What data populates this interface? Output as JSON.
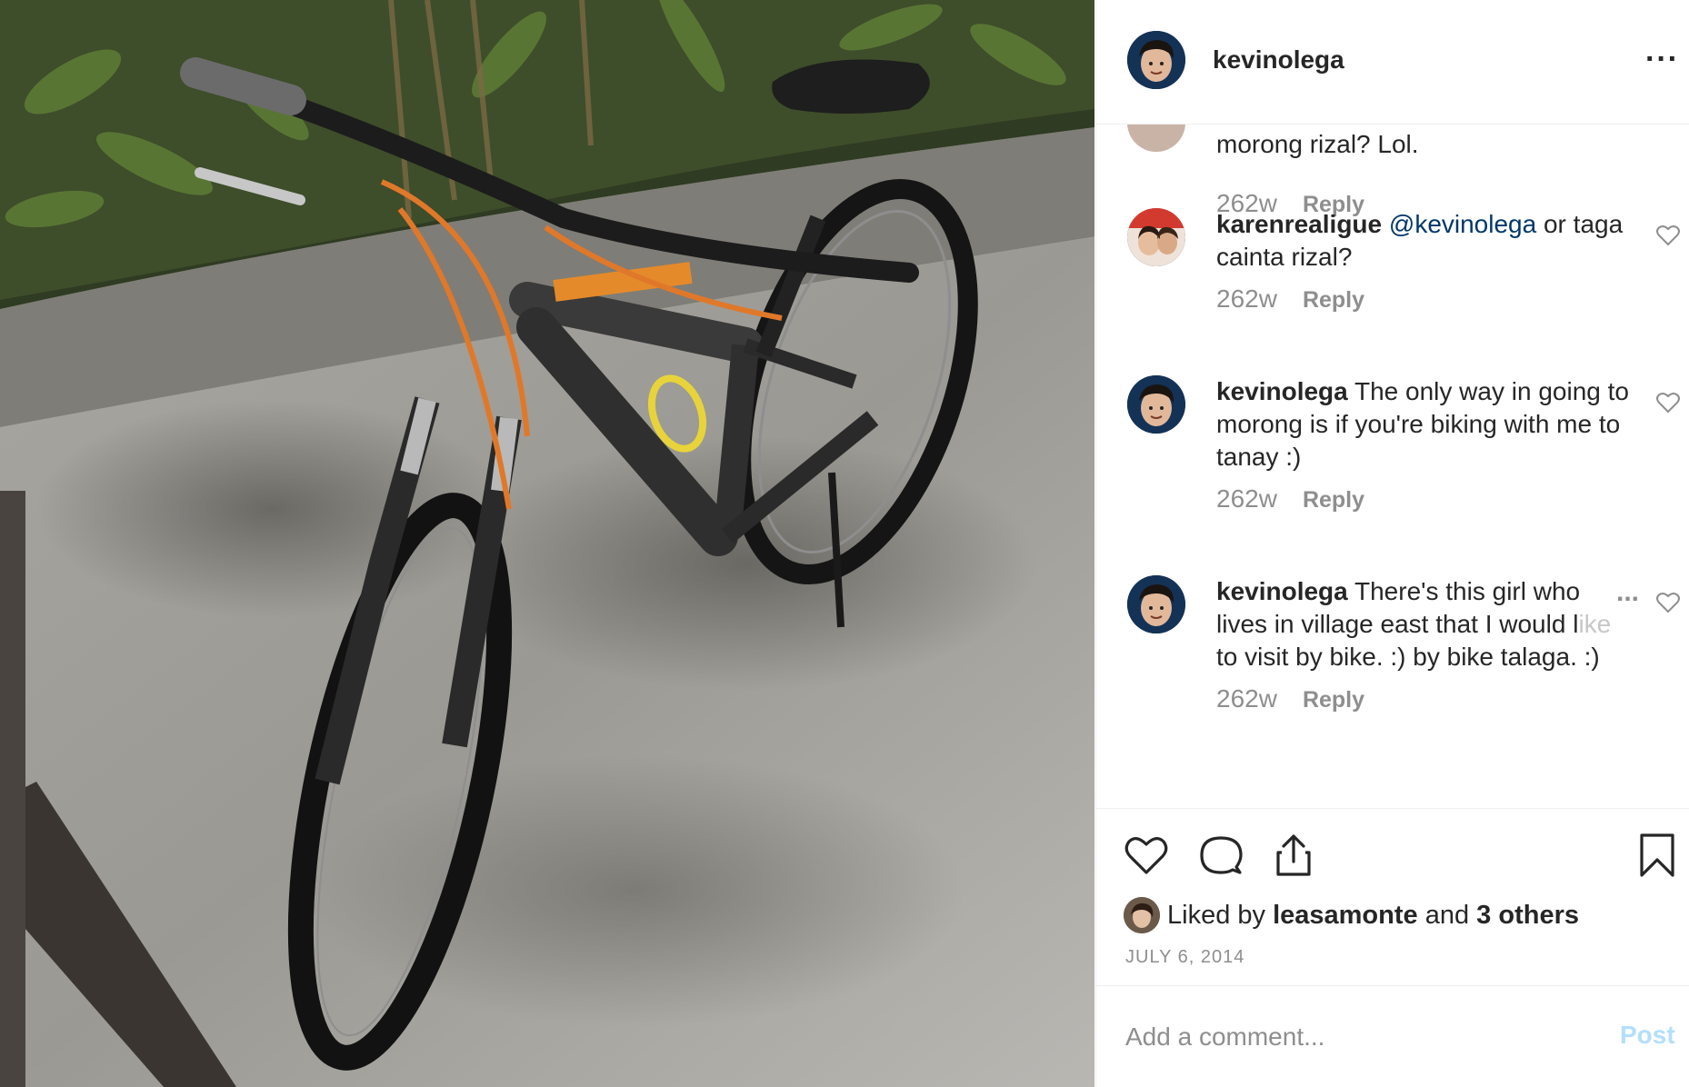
{
  "post": {
    "author": "kevinolega",
    "more_icon": "more-horizontal-icon",
    "liked_by_prefix": "Liked by",
    "liked_by_user": "leasamonte",
    "liked_by_joiner": "and",
    "liked_by_others": "3 others",
    "date": "JULY 6, 2014"
  },
  "comments": [
    {
      "text": "morong rizal? Lol.",
      "time": "262w",
      "reply": "Reply"
    },
    {
      "user": "karenrealigue",
      "mention": "@kevinolega",
      "text": " or taga cainta rizal?",
      "time": "262w",
      "reply": "Reply"
    },
    {
      "user": "kevinolega",
      "text": " The only way in going to morong is if you're biking with me to tanay :)",
      "time": "262w",
      "reply": "Reply"
    },
    {
      "user": "kevinolega",
      "text_a": " There's this girl who lives in village east that I would l",
      "text_fade": "ike",
      "text_b": " to visit by bike. :) by bike talaga. :)",
      "more": "...",
      "time": "262w",
      "reply": "Reply"
    }
  ],
  "actions": {
    "like_icon": "heart-icon",
    "comment_icon": "comment-bubble-icon",
    "share_icon": "share-icon",
    "save_icon": "bookmark-icon"
  },
  "add_comment": {
    "placeholder": "Add a comment...",
    "post_label": "Post"
  },
  "colors": {
    "link_blue": "#00376b",
    "post_button_disabled": "#b2dffc",
    "secondary_text": "#8e8e8e"
  }
}
